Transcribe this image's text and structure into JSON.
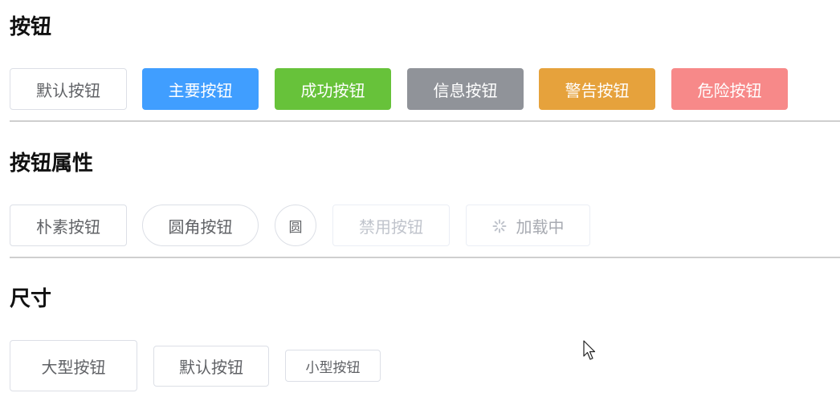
{
  "sections": {
    "basic": {
      "title": "按钮",
      "buttons": {
        "default": "默认按钮",
        "primary": "主要按钮",
        "success": "成功按钮",
        "info": "信息按钮",
        "warning": "警告按钮",
        "danger": "危险按钮"
      }
    },
    "attributes": {
      "title": "按钮属性",
      "buttons": {
        "plain": "朴素按钮",
        "round": "圆角按钮",
        "circle": "圆",
        "disabled": "禁用按钮",
        "loading": "加载中"
      }
    },
    "size": {
      "title": "尺寸",
      "buttons": {
        "large": "大型按钮",
        "default": "默认按钮",
        "small": "小型按钮"
      }
    }
  },
  "colors": {
    "primary": "#409eff",
    "success": "#67c23a",
    "info": "#909399",
    "warning": "#e6a23c",
    "danger": "#f78989"
  }
}
